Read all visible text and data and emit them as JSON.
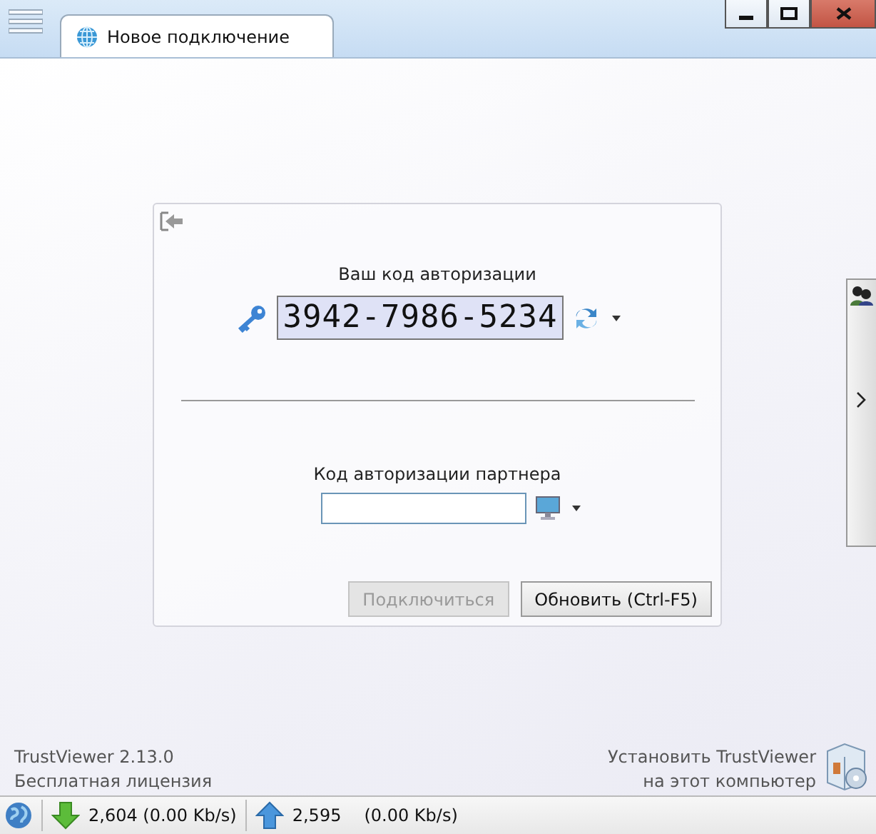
{
  "tabs": [
    {
      "label": "Новое подключение",
      "selected": true
    }
  ],
  "own_code": {
    "title": "Ваш код авторизации",
    "code": "3942-7986-5234"
  },
  "partner": {
    "title": "Код авторизации партнера"
  },
  "buttons": [
    {
      "label": "Подключиться",
      "disabled": true
    },
    {
      "label": "Обновить (Ctrl-F5)",
      "disabled": false
    }
  ],
  "footer": {
    "version": "TrustViewer 2.13.0",
    "license": "Бесплатная лицензия",
    "install_line_1": "Установить TrustViewer",
    "install_line_2": "на этот компьютер"
  },
  "status_bar": {
    "download": "2,604 (0.00 Kb/s)",
    "upload_count": "2,595",
    "upload_rate": "(0.00 Kb/s)"
  }
}
